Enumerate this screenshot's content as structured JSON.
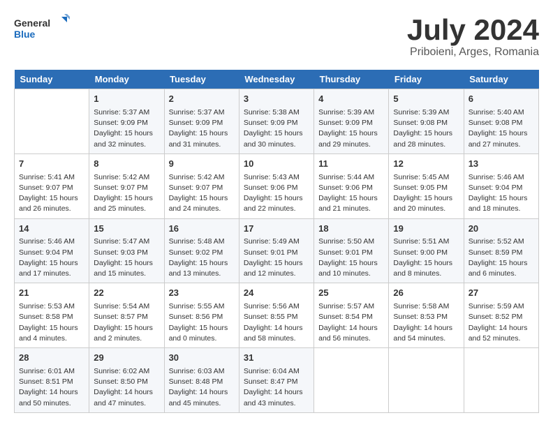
{
  "logo": {
    "line1": "General",
    "line2": "Blue"
  },
  "title": "July 2024",
  "location": "Priboieni, Arges, Romania",
  "days_of_week": [
    "Sunday",
    "Monday",
    "Tuesday",
    "Wednesday",
    "Thursday",
    "Friday",
    "Saturday"
  ],
  "weeks": [
    [
      {
        "day": "",
        "info": ""
      },
      {
        "day": "1",
        "info": "Sunrise: 5:37 AM\nSunset: 9:09 PM\nDaylight: 15 hours\nand 32 minutes."
      },
      {
        "day": "2",
        "info": "Sunrise: 5:37 AM\nSunset: 9:09 PM\nDaylight: 15 hours\nand 31 minutes."
      },
      {
        "day": "3",
        "info": "Sunrise: 5:38 AM\nSunset: 9:09 PM\nDaylight: 15 hours\nand 30 minutes."
      },
      {
        "day": "4",
        "info": "Sunrise: 5:39 AM\nSunset: 9:09 PM\nDaylight: 15 hours\nand 29 minutes."
      },
      {
        "day": "5",
        "info": "Sunrise: 5:39 AM\nSunset: 9:08 PM\nDaylight: 15 hours\nand 28 minutes."
      },
      {
        "day": "6",
        "info": "Sunrise: 5:40 AM\nSunset: 9:08 PM\nDaylight: 15 hours\nand 27 minutes."
      }
    ],
    [
      {
        "day": "7",
        "info": "Sunrise: 5:41 AM\nSunset: 9:07 PM\nDaylight: 15 hours\nand 26 minutes."
      },
      {
        "day": "8",
        "info": "Sunrise: 5:42 AM\nSunset: 9:07 PM\nDaylight: 15 hours\nand 25 minutes."
      },
      {
        "day": "9",
        "info": "Sunrise: 5:42 AM\nSunset: 9:07 PM\nDaylight: 15 hours\nand 24 minutes."
      },
      {
        "day": "10",
        "info": "Sunrise: 5:43 AM\nSunset: 9:06 PM\nDaylight: 15 hours\nand 22 minutes."
      },
      {
        "day": "11",
        "info": "Sunrise: 5:44 AM\nSunset: 9:06 PM\nDaylight: 15 hours\nand 21 minutes."
      },
      {
        "day": "12",
        "info": "Sunrise: 5:45 AM\nSunset: 9:05 PM\nDaylight: 15 hours\nand 20 minutes."
      },
      {
        "day": "13",
        "info": "Sunrise: 5:46 AM\nSunset: 9:04 PM\nDaylight: 15 hours\nand 18 minutes."
      }
    ],
    [
      {
        "day": "14",
        "info": "Sunrise: 5:46 AM\nSunset: 9:04 PM\nDaylight: 15 hours\nand 17 minutes."
      },
      {
        "day": "15",
        "info": "Sunrise: 5:47 AM\nSunset: 9:03 PM\nDaylight: 15 hours\nand 15 minutes."
      },
      {
        "day": "16",
        "info": "Sunrise: 5:48 AM\nSunset: 9:02 PM\nDaylight: 15 hours\nand 13 minutes."
      },
      {
        "day": "17",
        "info": "Sunrise: 5:49 AM\nSunset: 9:01 PM\nDaylight: 15 hours\nand 12 minutes."
      },
      {
        "day": "18",
        "info": "Sunrise: 5:50 AM\nSunset: 9:01 PM\nDaylight: 15 hours\nand 10 minutes."
      },
      {
        "day": "19",
        "info": "Sunrise: 5:51 AM\nSunset: 9:00 PM\nDaylight: 15 hours\nand 8 minutes."
      },
      {
        "day": "20",
        "info": "Sunrise: 5:52 AM\nSunset: 8:59 PM\nDaylight: 15 hours\nand 6 minutes."
      }
    ],
    [
      {
        "day": "21",
        "info": "Sunrise: 5:53 AM\nSunset: 8:58 PM\nDaylight: 15 hours\nand 4 minutes."
      },
      {
        "day": "22",
        "info": "Sunrise: 5:54 AM\nSunset: 8:57 PM\nDaylight: 15 hours\nand 2 minutes."
      },
      {
        "day": "23",
        "info": "Sunrise: 5:55 AM\nSunset: 8:56 PM\nDaylight: 15 hours\nand 0 minutes."
      },
      {
        "day": "24",
        "info": "Sunrise: 5:56 AM\nSunset: 8:55 PM\nDaylight: 14 hours\nand 58 minutes."
      },
      {
        "day": "25",
        "info": "Sunrise: 5:57 AM\nSunset: 8:54 PM\nDaylight: 14 hours\nand 56 minutes."
      },
      {
        "day": "26",
        "info": "Sunrise: 5:58 AM\nSunset: 8:53 PM\nDaylight: 14 hours\nand 54 minutes."
      },
      {
        "day": "27",
        "info": "Sunrise: 5:59 AM\nSunset: 8:52 PM\nDaylight: 14 hours\nand 52 minutes."
      }
    ],
    [
      {
        "day": "28",
        "info": "Sunrise: 6:01 AM\nSunset: 8:51 PM\nDaylight: 14 hours\nand 50 minutes."
      },
      {
        "day": "29",
        "info": "Sunrise: 6:02 AM\nSunset: 8:50 PM\nDaylight: 14 hours\nand 47 minutes."
      },
      {
        "day": "30",
        "info": "Sunrise: 6:03 AM\nSunset: 8:48 PM\nDaylight: 14 hours\nand 45 minutes."
      },
      {
        "day": "31",
        "info": "Sunrise: 6:04 AM\nSunset: 8:47 PM\nDaylight: 14 hours\nand 43 minutes."
      },
      {
        "day": "",
        "info": ""
      },
      {
        "day": "",
        "info": ""
      },
      {
        "day": "",
        "info": ""
      }
    ]
  ]
}
